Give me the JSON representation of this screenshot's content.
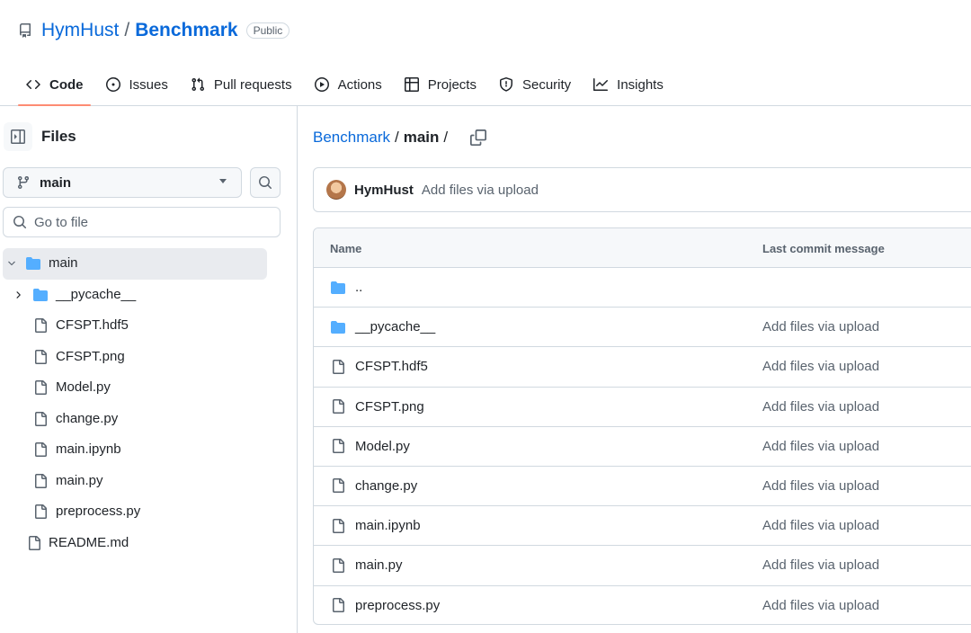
{
  "header": {
    "owner": "HymHust",
    "separator": "/",
    "repo": "Benchmark",
    "visibility": "Public",
    "tabs": [
      {
        "label": "Code",
        "icon": "code-icon",
        "selected": true
      },
      {
        "label": "Issues",
        "icon": "issue-opened-icon"
      },
      {
        "label": "Pull requests",
        "icon": "git-pull-request-icon"
      },
      {
        "label": "Actions",
        "icon": "play-icon"
      },
      {
        "label": "Projects",
        "icon": "table-icon"
      },
      {
        "label": "Security",
        "icon": "shield-icon"
      },
      {
        "label": "Insights",
        "icon": "graph-icon"
      }
    ]
  },
  "sidebar": {
    "title": "Files",
    "branch": "main",
    "goto_placeholder": "Go to file",
    "tree": [
      {
        "label": "main",
        "type": "folder",
        "expanded": true,
        "active": true
      },
      {
        "label": "__pycache__",
        "type": "folder",
        "expanded": false
      },
      {
        "label": "CFSPT.hdf5",
        "type": "file"
      },
      {
        "label": "CFSPT.png",
        "type": "file"
      },
      {
        "label": "Model.py",
        "type": "file"
      },
      {
        "label": "change.py",
        "type": "file"
      },
      {
        "label": "main.ipynb",
        "type": "file"
      },
      {
        "label": "main.py",
        "type": "file"
      },
      {
        "label": "preprocess.py",
        "type": "file"
      },
      {
        "label": "README.md",
        "type": "file"
      }
    ]
  },
  "main": {
    "breadcrumb": {
      "repo": "Benchmark",
      "branch": "main",
      "sep": "/"
    },
    "commit": {
      "author": "HymHust",
      "message": "Add files via upload"
    },
    "table": {
      "columns": {
        "name": "Name",
        "message": "Last commit message"
      },
      "rows": [
        {
          "name": "..",
          "type": "folder",
          "message": ""
        },
        {
          "name": "__pycache__",
          "type": "folder",
          "message": "Add files via upload"
        },
        {
          "name": "CFSPT.hdf5",
          "type": "file",
          "message": "Add files via upload"
        },
        {
          "name": "CFSPT.png",
          "type": "file",
          "message": "Add files via upload"
        },
        {
          "name": "Model.py",
          "type": "file",
          "message": "Add files via upload"
        },
        {
          "name": "change.py",
          "type": "file",
          "message": "Add files via upload"
        },
        {
          "name": "main.ipynb",
          "type": "file",
          "message": "Add files via upload"
        },
        {
          "name": "main.py",
          "type": "file",
          "message": "Add files via upload"
        },
        {
          "name": "preprocess.py",
          "type": "file",
          "message": "Add files via upload"
        }
      ]
    }
  },
  "colors": {
    "link": "#0969da",
    "folder": "#54aeff",
    "tab_underline": "#fd8c73",
    "muted": "#59636e",
    "border": "#d1d9e0"
  }
}
